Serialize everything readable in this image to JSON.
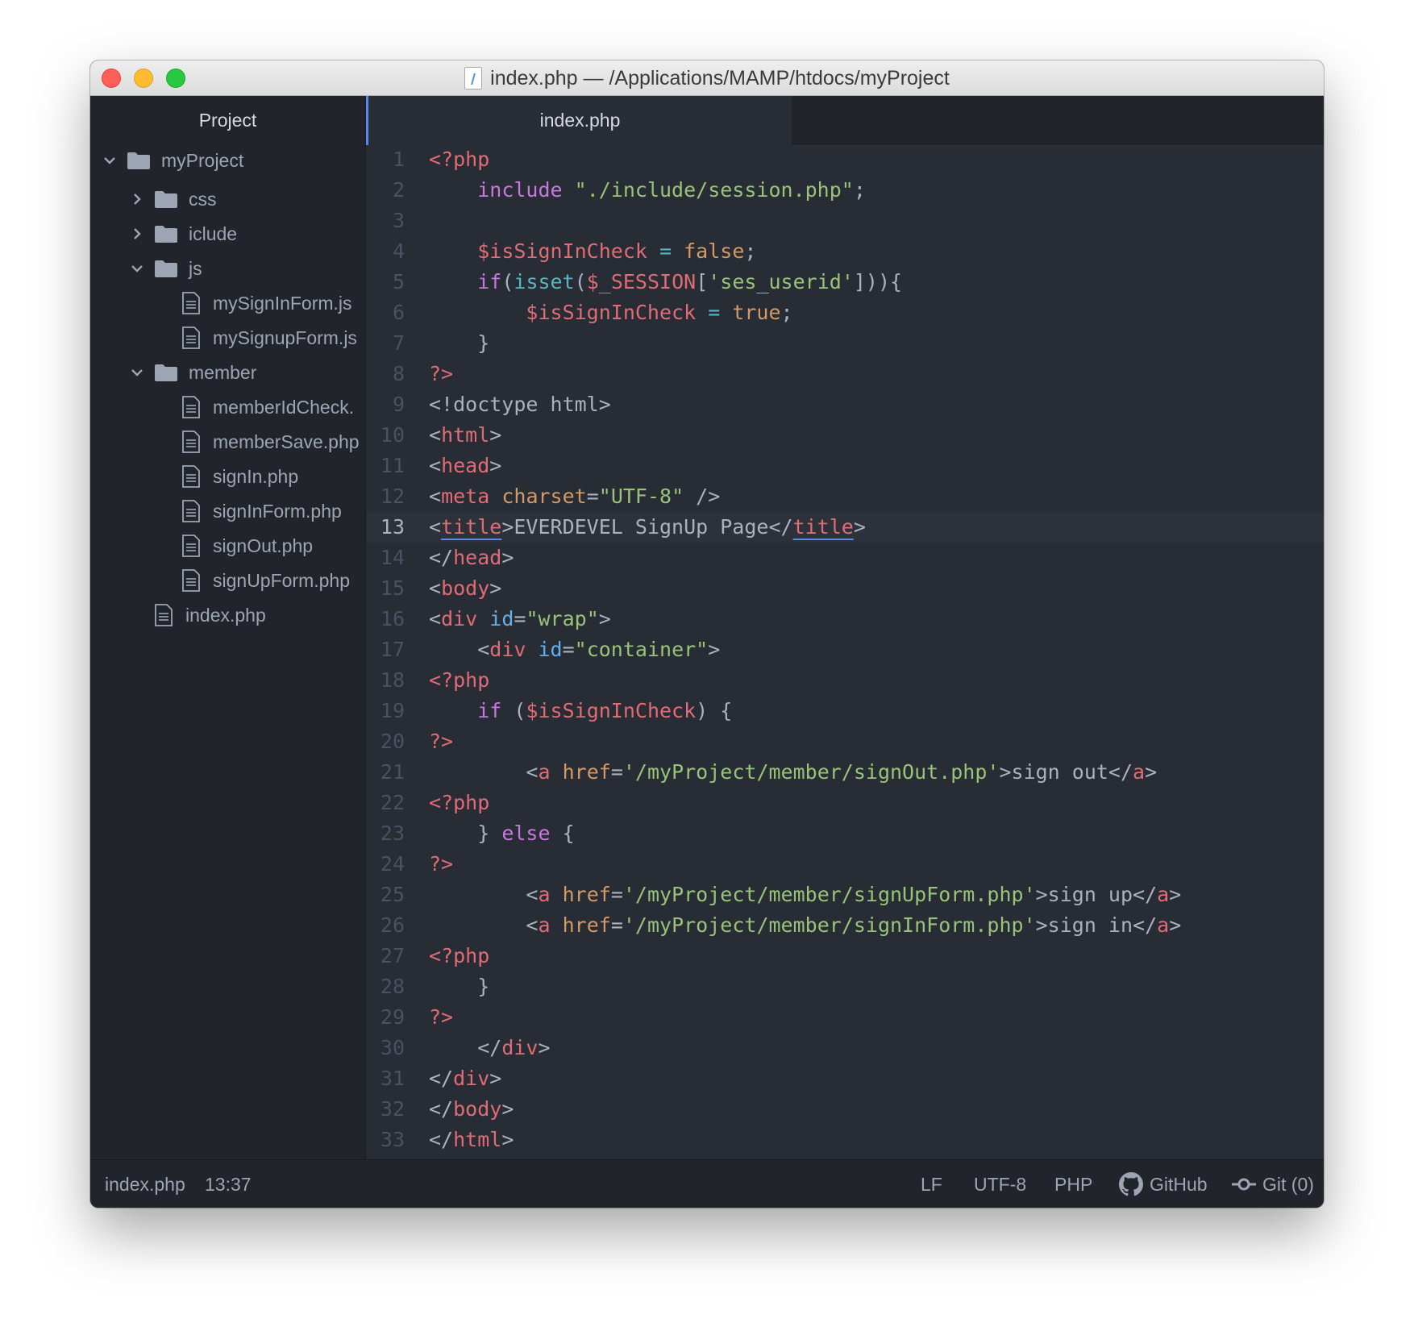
{
  "window": {
    "title": "index.php — /Applications/MAMP/htdocs/myProject"
  },
  "sidebar": {
    "header": "Project",
    "tree": [
      {
        "label": "myProject",
        "type": "folder",
        "expanded": true,
        "depth": 0
      },
      {
        "label": "css",
        "type": "folder",
        "expanded": false,
        "depth": 1
      },
      {
        "label": "iclude",
        "type": "folder",
        "expanded": false,
        "depth": 1
      },
      {
        "label": "js",
        "type": "folder",
        "expanded": true,
        "depth": 1
      },
      {
        "label": "mySignInForm.js",
        "type": "file",
        "depth": 2
      },
      {
        "label": "mySignupForm.js",
        "type": "file",
        "depth": 2
      },
      {
        "label": "member",
        "type": "folder",
        "expanded": true,
        "depth": 1
      },
      {
        "label": "memberIdCheck.",
        "type": "file",
        "depth": 2
      },
      {
        "label": "memberSave.php",
        "type": "file",
        "depth": 2
      },
      {
        "label": "signIn.php",
        "type": "file",
        "depth": 2
      },
      {
        "label": "signInForm.php",
        "type": "file",
        "depth": 2
      },
      {
        "label": "signOut.php",
        "type": "file",
        "depth": 2
      },
      {
        "label": "signUpForm.php",
        "type": "file",
        "depth": 2
      },
      {
        "label": "index.php",
        "type": "file",
        "depth": 1
      }
    ]
  },
  "tabs": [
    {
      "label": "index.php",
      "active": true
    }
  ],
  "editor": {
    "current_line": 13,
    "lines": [
      [
        [
          "red",
          "<?php"
        ]
      ],
      [
        [
          "t",
          "    "
        ],
        [
          "pur",
          "include"
        ],
        [
          "t",
          " "
        ],
        [
          "grn",
          "\"./include/session.php\""
        ],
        [
          "t",
          ";"
        ]
      ],
      [],
      [
        [
          "t",
          "    "
        ],
        [
          "red",
          "$isSignInCheck"
        ],
        [
          "t",
          " "
        ],
        [
          "cyn",
          "="
        ],
        [
          "t",
          " "
        ],
        [
          "org",
          "false"
        ],
        [
          "t",
          ";"
        ]
      ],
      [
        [
          "t",
          "    "
        ],
        [
          "pur",
          "if"
        ],
        [
          "t",
          "("
        ],
        [
          "cyn",
          "isset"
        ],
        [
          "t",
          "("
        ],
        [
          "red",
          "$_SESSION"
        ],
        [
          "t",
          "["
        ],
        [
          "grn",
          "'ses_userid'"
        ],
        [
          "t",
          "])){"
        ]
      ],
      [
        [
          "t",
          "        "
        ],
        [
          "red",
          "$isSignInCheck"
        ],
        [
          "t",
          " "
        ],
        [
          "cyn",
          "="
        ],
        [
          "t",
          " "
        ],
        [
          "org",
          "true"
        ],
        [
          "t",
          ";"
        ]
      ],
      [
        [
          "t",
          "    }"
        ]
      ],
      [
        [
          "red",
          "?>"
        ]
      ],
      [
        [
          "t",
          "<!doctype html>"
        ]
      ],
      [
        [
          "t",
          "<"
        ],
        [
          "red",
          "html"
        ],
        [
          "t",
          ">"
        ]
      ],
      [
        [
          "t",
          "<"
        ],
        [
          "red",
          "head"
        ],
        [
          "t",
          ">"
        ]
      ],
      [
        [
          "t",
          "<"
        ],
        [
          "red",
          "meta"
        ],
        [
          "t",
          " "
        ],
        [
          "org",
          "charset"
        ],
        [
          "t",
          "="
        ],
        [
          "grn",
          "\"UTF-8\""
        ],
        [
          "t",
          " />"
        ]
      ],
      [
        [
          "t",
          "<"
        ],
        [
          "red und",
          "title"
        ],
        [
          "t",
          ">EVERDEVEL SignUp Page</"
        ],
        [
          "red und",
          "title"
        ],
        [
          "t",
          ">"
        ]
      ],
      [
        [
          "t",
          "</"
        ],
        [
          "red",
          "head"
        ],
        [
          "t",
          ">"
        ]
      ],
      [
        [
          "t",
          "<"
        ],
        [
          "red",
          "body"
        ],
        [
          "t",
          ">"
        ]
      ],
      [
        [
          "t",
          "<"
        ],
        [
          "red",
          "div"
        ],
        [
          "t",
          " "
        ],
        [
          "blu",
          "id"
        ],
        [
          "t",
          "="
        ],
        [
          "grn",
          "\"wrap\""
        ],
        [
          "t",
          ">"
        ]
      ],
      [
        [
          "t",
          "    <"
        ],
        [
          "red",
          "div"
        ],
        [
          "t",
          " "
        ],
        [
          "blu",
          "id"
        ],
        [
          "t",
          "="
        ],
        [
          "grn",
          "\"container\""
        ],
        [
          "t",
          ">"
        ]
      ],
      [
        [
          "red",
          "<?php"
        ]
      ],
      [
        [
          "t",
          "    "
        ],
        [
          "pur",
          "if"
        ],
        [
          "t",
          " ("
        ],
        [
          "red",
          "$isSignInCheck"
        ],
        [
          "t",
          ") {"
        ]
      ],
      [
        [
          "red",
          "?>"
        ]
      ],
      [
        [
          "t",
          "        <"
        ],
        [
          "red",
          "a"
        ],
        [
          "t",
          " "
        ],
        [
          "org",
          "href"
        ],
        [
          "t",
          "="
        ],
        [
          "grn",
          "'/myProject/member/signOut.php'"
        ],
        [
          "t",
          ">sign out</"
        ],
        [
          "red",
          "a"
        ],
        [
          "t",
          ">"
        ]
      ],
      [
        [
          "red",
          "<?php"
        ]
      ],
      [
        [
          "t",
          "    } "
        ],
        [
          "pur",
          "else"
        ],
        [
          "t",
          " {"
        ]
      ],
      [
        [
          "red",
          "?>"
        ]
      ],
      [
        [
          "t",
          "        <"
        ],
        [
          "red",
          "a"
        ],
        [
          "t",
          " "
        ],
        [
          "org",
          "href"
        ],
        [
          "t",
          "="
        ],
        [
          "grn",
          "'/myProject/member/signUpForm.php'"
        ],
        [
          "t",
          ">sign up</"
        ],
        [
          "red",
          "a"
        ],
        [
          "t",
          ">"
        ]
      ],
      [
        [
          "t",
          "        <"
        ],
        [
          "red",
          "a"
        ],
        [
          "t",
          " "
        ],
        [
          "org",
          "href"
        ],
        [
          "t",
          "="
        ],
        [
          "grn",
          "'/myProject/member/signInForm.php'"
        ],
        [
          "t",
          ">sign in</"
        ],
        [
          "red",
          "a"
        ],
        [
          "t",
          ">"
        ]
      ],
      [
        [
          "red",
          "<?php"
        ]
      ],
      [
        [
          "t",
          "    }"
        ]
      ],
      [
        [
          "red",
          "?>"
        ]
      ],
      [
        [
          "t",
          "    </"
        ],
        [
          "red",
          "div"
        ],
        [
          "t",
          ">"
        ]
      ],
      [
        [
          "t",
          "</"
        ],
        [
          "red",
          "div"
        ],
        [
          "t",
          ">"
        ]
      ],
      [
        [
          "t",
          "</"
        ],
        [
          "red",
          "body"
        ],
        [
          "t",
          ">"
        ]
      ],
      [
        [
          "t",
          "</"
        ],
        [
          "red",
          "html"
        ],
        [
          "t",
          ">"
        ]
      ]
    ]
  },
  "statusbar": {
    "file": "index.php",
    "cursor": "13:37",
    "line_ending": "LF",
    "encoding": "UTF-8",
    "grammar": "PHP",
    "github": "GitHub",
    "git": "Git (0)"
  },
  "colors": {
    "accent": "#568af2",
    "bg": "#282c34",
    "panel": "#21252b"
  }
}
